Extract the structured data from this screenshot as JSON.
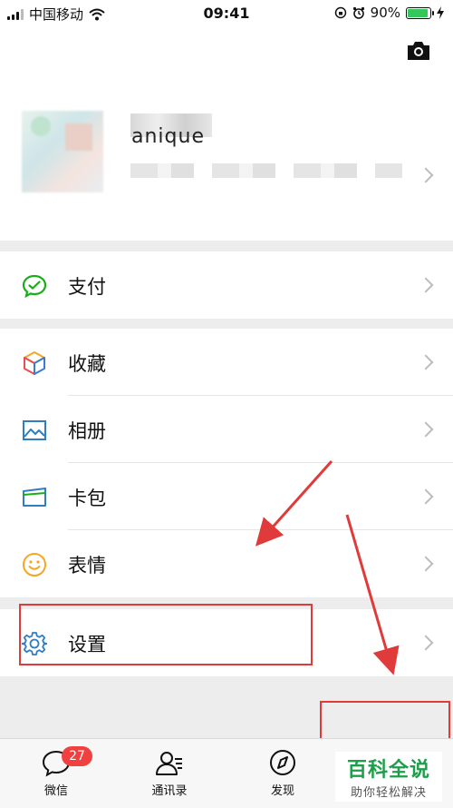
{
  "status_bar": {
    "carrier": "中国移动",
    "time": "09:41",
    "battery": "90%"
  },
  "profile": {
    "nickname": "anique"
  },
  "menu": {
    "pay": "支付",
    "favorites": "收藏",
    "album": "相册",
    "cards": "卡包",
    "stickers": "表情",
    "settings": "设置"
  },
  "tabbar": {
    "chats": "微信",
    "chats_badge": "27",
    "contacts": "通讯录",
    "discover": "发现"
  },
  "watermark": {
    "title": "百科全说",
    "subtitle": "助你轻松解决"
  },
  "colors": {
    "accent_green": "#1aad19",
    "highlight_red": "#e03a3a",
    "badge_red": "#f04040"
  }
}
